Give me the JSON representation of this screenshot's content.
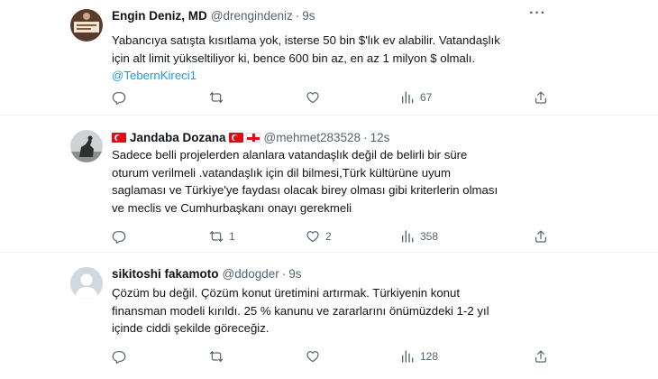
{
  "tweets": [
    {
      "name": "Engin Deniz, MD",
      "handle": "@drengindeniz",
      "time": "9s",
      "lines": [
        "Yabancıya satışta kısıtlama yok, isterse 50 bin $'lık ev alabilir. Vatandaşlık",
        "için alt limit yükseltiliyor ki, bence 600 bin az, en az 1 milyon $ olmalı."
      ],
      "mention": "@TebernKireci1",
      "reply_count": "",
      "retweet_count": "",
      "like_count": "",
      "view_count": "67"
    },
    {
      "name": "Jandaba Dozana",
      "handle": "@mehmet283528",
      "time": "12s",
      "lines": [
        "Sadece belli projelerden alanlara vatandaşlık değil de belirli bir süre",
        "oturum verilmeli .vatandaşlık için dil bilmesi,Türk kültürüne uyum",
        "saglaması ve Türkiye'ye faydası olacak  birey olması gibi kriterlerin olması",
        "ve meclis ve Cumhurbaşkanı onayı gerekmeli"
      ],
      "reply_count": "",
      "retweet_count": "1",
      "like_count": "2",
      "view_count": "358"
    },
    {
      "name": "sikitoshi fakamoto",
      "handle": "@ddogder",
      "time": "9s",
      "lines": [
        "Çözüm bu değil. Çözüm konut üretimini artırmak. Türkiyenin konut",
        "finansman modeli kırıldı. 25 % kanunu ve zararlarını önümüzdeki 1-2 yıl",
        "içinde ciddi şekilde göreceğiz."
      ],
      "reply_count": "",
      "retweet_count": "",
      "like_count": "",
      "view_count": "128"
    }
  ],
  "icons": {
    "reply": "reply-icon",
    "retweet": "retweet-icon",
    "like": "heart-icon",
    "views": "views-icon",
    "share": "share-icon",
    "more": "more-icon"
  },
  "colors": {
    "text": "#0f1419",
    "secondary": "#536471",
    "link": "#1d9bf0",
    "divider": "#eff3f4"
  },
  "separator": "·",
  "more_glyph": "···"
}
